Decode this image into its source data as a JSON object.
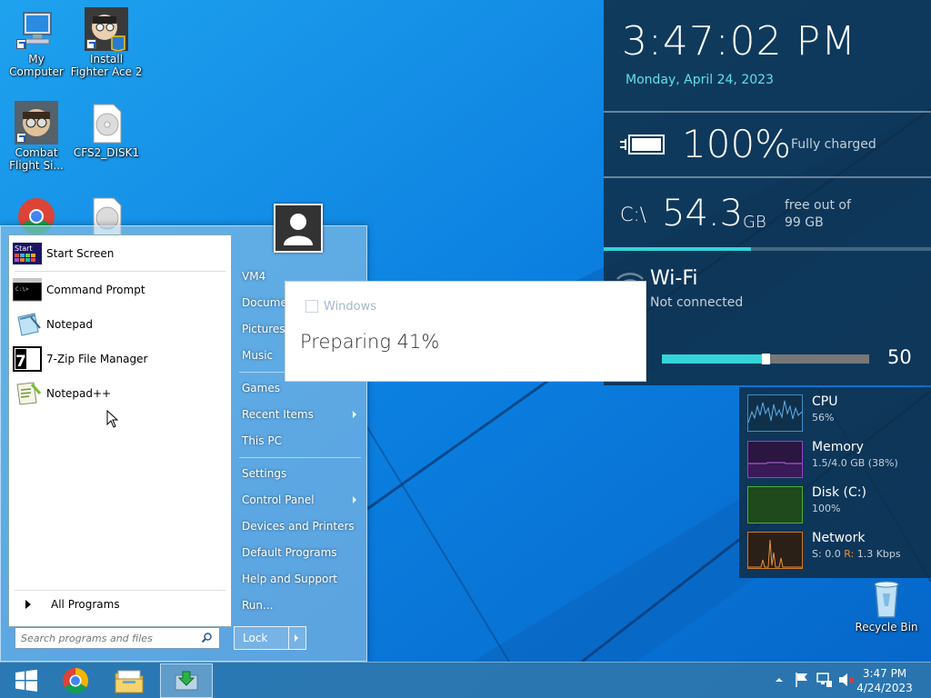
{
  "desktop": {
    "icons": [
      {
        "label": "My Computer"
      },
      {
        "label": "Install Fighter Ace 2"
      },
      {
        "label": "Combat Flight Si..."
      },
      {
        "label": "CFS2_DISK1"
      },
      {
        "label": "Recycle Bin"
      }
    ]
  },
  "start_menu": {
    "programs": [
      {
        "label": "Start Screen",
        "icon": "start-screen-icon",
        "icon_text": "Start"
      },
      {
        "label": "Command Prompt",
        "icon": "command-prompt-icon",
        "icon_text": "C:\\>"
      },
      {
        "label": "Notepad",
        "icon": "notepad-icon"
      },
      {
        "label": "7-Zip File Manager",
        "icon": "7zip-icon",
        "icon_text": "7z"
      },
      {
        "label": "Notepad++",
        "icon": "notepad-plus-plus-icon"
      }
    ],
    "all_programs": "All Programs",
    "search_placeholder": "Search programs and files",
    "right_items": [
      {
        "label": "VM4"
      },
      {
        "label": "Documents"
      },
      {
        "label": "Pictures"
      },
      {
        "label": "Music"
      },
      {
        "label": "Games"
      },
      {
        "label": "Recent Items",
        "submenu": true
      },
      {
        "label": "This PC"
      },
      {
        "label": "Settings"
      },
      {
        "label": "Control Panel",
        "submenu": true
      },
      {
        "label": "Devices and Printers"
      },
      {
        "label": "Default Programs"
      },
      {
        "label": "Help and Support"
      },
      {
        "label": "Run..."
      }
    ],
    "lock_label": "Lock"
  },
  "dialog": {
    "title": "Windows",
    "status": "Preparing 41%"
  },
  "info_panel": {
    "time": "3:47:02 PM",
    "date": "Monday, April 24, 2023",
    "battery": {
      "percent": "100%",
      "status": "Fully charged"
    },
    "disk": {
      "drive": "C:\\",
      "free": "54.3",
      "unit": "GB",
      "line1": "free out of",
      "line2": "99 GB",
      "used_fraction": 0.45
    },
    "wifi": {
      "title": "Wi-Fi",
      "status": "Not connected"
    },
    "volume": {
      "value": "50",
      "level": 0.5
    },
    "accent": "#33d4d9"
  },
  "perf": [
    {
      "name": "CPU",
      "value": "56%",
      "color": "#3a8fc8"
    },
    {
      "name": "Memory",
      "value": "1.5/4.0 GB (38%)",
      "color": "#9b3fc8"
    },
    {
      "name": "Disk (C:)",
      "value": "100%",
      "color": "#4caf3c"
    },
    {
      "name": "Network",
      "send_label": "S:",
      "send": "0.0",
      "recv_label": "R:",
      "recv": "1.3 Kbps",
      "color": "#d0782a"
    }
  ],
  "taskbar": {
    "time": "3:47 PM",
    "date": "4/24/2023"
  }
}
